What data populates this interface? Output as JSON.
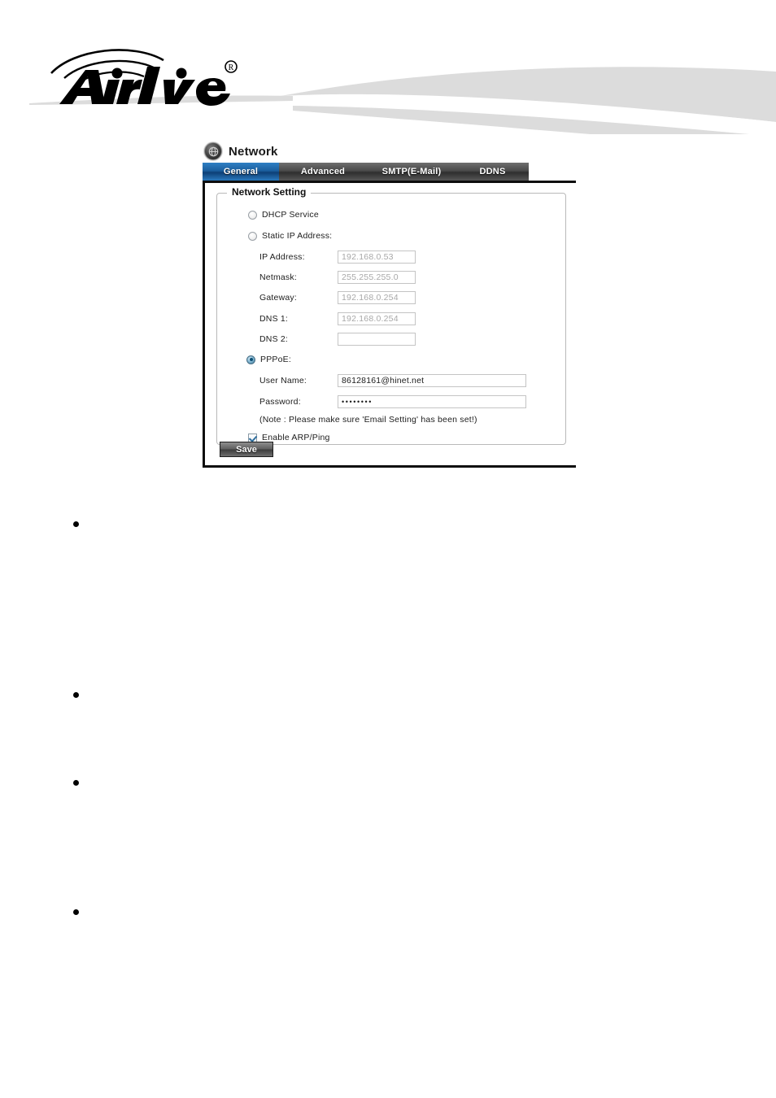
{
  "brand": {
    "name": "AirLive",
    "logo_text_air": "Air",
    "logo_text_live": "Live",
    "registered_mark": "®"
  },
  "panel": {
    "icon": "network-globe-icon",
    "title": "Network",
    "tabs": [
      {
        "label": "General",
        "active": true
      },
      {
        "label": "Advanced",
        "active": false
      },
      {
        "label": "SMTP(E-Mail)",
        "active": false
      },
      {
        "label": "DDNS",
        "active": false
      }
    ],
    "fieldset": {
      "legend": "Network Setting",
      "options": [
        {
          "label": "DHCP Service",
          "selected": false
        },
        {
          "label": "Static IP Address:",
          "selected": false
        },
        {
          "label": "PPPoE:",
          "selected": true
        }
      ],
      "static_fields": [
        {
          "label": "IP Address:",
          "value": "192.168.0.53",
          "disabled": true
        },
        {
          "label": "Netmask:",
          "value": "255.255.255.0",
          "disabled": true
        },
        {
          "label": "Gateway:",
          "value": "192.168.0.254",
          "disabled": true
        },
        {
          "label": "DNS 1:",
          "value": "192.168.0.254",
          "disabled": true
        },
        {
          "label": "DNS 2:",
          "value": "",
          "disabled": false
        }
      ],
      "pppoe_fields": [
        {
          "label": "User Name:",
          "value": "86128161@hinet.net"
        },
        {
          "label": "Password:",
          "value": "••••••••"
        }
      ],
      "note": "(Note : Please make sure 'Email Setting' has been set!)",
      "checkbox": {
        "label": "Enable ARP/Ping",
        "checked": true
      }
    },
    "save_label": "Save"
  },
  "body_bullets": [
    {
      "marker": "•"
    },
    {
      "marker": "•"
    },
    {
      "marker": "•"
    },
    {
      "marker": "•"
    }
  ],
  "colors": {
    "active_tab": "#1b5f9e",
    "tab_bar": "#4a4a4a",
    "swoosh": "#dcdcdc",
    "panel_border": "#0d0d0d"
  }
}
